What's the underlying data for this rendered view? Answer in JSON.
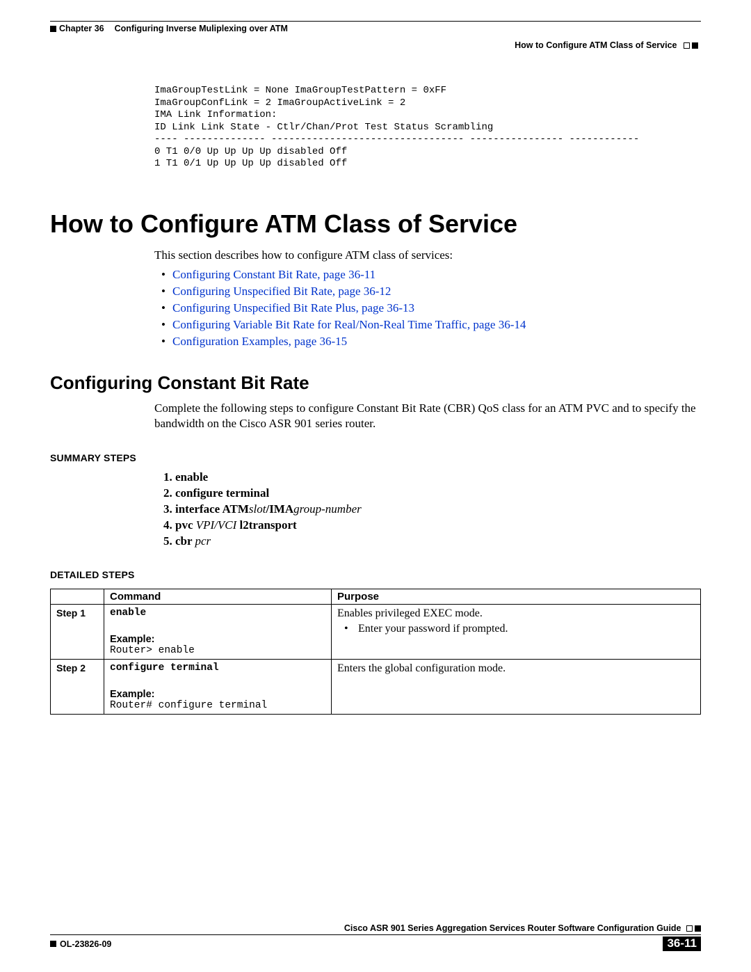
{
  "header": {
    "chapter_label": "Chapter 36",
    "chapter_title": "Configuring Inverse Muliplexing over ATM",
    "section_title": "How to Configure ATM Class of Service"
  },
  "code_lines": [
    "ImaGroupTestLink = None ImaGroupTestPattern = 0xFF",
    "ImaGroupConfLink = 2 ImaGroupActiveLink = 2",
    "IMA Link Information:",
    "ID Link Link State - Ctlr/Chan/Prot Test Status Scrambling",
    "---- -------------- --------------------------------- ---------------- ------------",
    "0 T1 0/0 Up Up Up Up disabled Off",
    "1 T1 0/1 Up Up Up Up disabled Off"
  ],
  "h1": "How to Configure ATM Class of Service",
  "intro": "This section describes how to configure ATM class of services:",
  "links": [
    "Configuring Constant Bit Rate, page 36-11",
    "Configuring Unspecified Bit Rate, page 36-12",
    "Configuring Unspecified Bit Rate Plus, page 36-13",
    "Configuring Variable Bit Rate for Real/Non-Real Time Traffic, page 36-14",
    "Configuration Examples, page 36-15"
  ],
  "h2": "Configuring Constant Bit Rate",
  "h2_para": "Complete the following steps to configure Constant Bit Rate (CBR) QoS class for an ATM PVC and to specify the bandwidth on the Cisco ASR 901 series router.",
  "summary_heading": "SUMMARY STEPS",
  "summary_steps": [
    {
      "bold": "enable",
      "ital": ""
    },
    {
      "bold": "configure terminal",
      "ital": ""
    },
    {
      "bold_a": "interface ATM",
      "ital_a": "slot",
      "bold_b": "/IMA",
      "ital_b": "group-number"
    },
    {
      "bold_a": "pvc ",
      "ital_a": "VPI/VCI",
      "bold_b": " l2transport",
      "ital_b": ""
    },
    {
      "bold_a": "cbr ",
      "ital_a": "pcr",
      "bold_b": "",
      "ital_b": ""
    }
  ],
  "detailed_heading": "DETAILED STEPS",
  "table": {
    "head_blank": "",
    "head_cmd": "Command",
    "head_purpose": "Purpose",
    "rows": [
      {
        "step": "Step 1",
        "cmd": "enable",
        "example_label": "Example:",
        "example_code": "Router> enable",
        "purpose_main": "Enables privileged EXEC mode.",
        "purpose_bullet": "Enter your password if prompted."
      },
      {
        "step": "Step 2",
        "cmd": "configure terminal",
        "example_label": "Example:",
        "example_code": "Router# configure terminal",
        "purpose_main": "Enters the global configuration mode.",
        "purpose_bullet": ""
      }
    ]
  },
  "footer": {
    "guide_title": "Cisco ASR 901 Series Aggregation Services Router Software Configuration Guide",
    "doc_id": "OL-23826-09",
    "page_num": "36-11"
  }
}
